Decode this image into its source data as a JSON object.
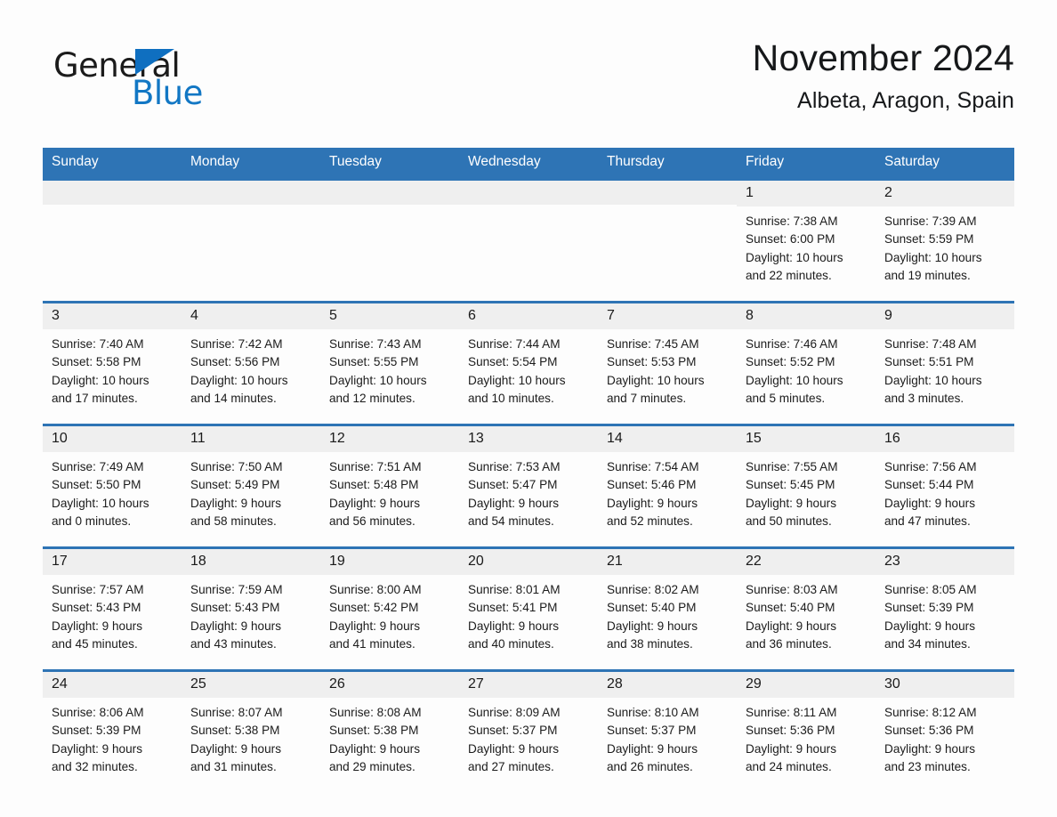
{
  "logo": {
    "word_general": "General",
    "word_blue": "Blue",
    "triangle_color": "#0f6fc0",
    "blue_text_color": "#1277c4"
  },
  "header": {
    "month_title": "November 2024",
    "location": "Albeta, Aragon, Spain"
  },
  "theme": {
    "header_blue": "#2e74b5",
    "day_band_gray": "#efefef",
    "page_background": "#fdfdfd"
  },
  "calendar": {
    "weekdays": [
      "Sunday",
      "Monday",
      "Tuesday",
      "Wednesday",
      "Thursday",
      "Friday",
      "Saturday"
    ],
    "weeks": [
      [
        {
          "day": "",
          "lines": []
        },
        {
          "day": "",
          "lines": []
        },
        {
          "day": "",
          "lines": []
        },
        {
          "day": "",
          "lines": []
        },
        {
          "day": "",
          "lines": []
        },
        {
          "day": "1",
          "lines": [
            "Sunrise: 7:38 AM",
            "Sunset: 6:00 PM",
            "Daylight: 10 hours",
            "and 22 minutes."
          ]
        },
        {
          "day": "2",
          "lines": [
            "Sunrise: 7:39 AM",
            "Sunset: 5:59 PM",
            "Daylight: 10 hours",
            "and 19 minutes."
          ]
        }
      ],
      [
        {
          "day": "3",
          "lines": [
            "Sunrise: 7:40 AM",
            "Sunset: 5:58 PM",
            "Daylight: 10 hours",
            "and 17 minutes."
          ]
        },
        {
          "day": "4",
          "lines": [
            "Sunrise: 7:42 AM",
            "Sunset: 5:56 PM",
            "Daylight: 10 hours",
            "and 14 minutes."
          ]
        },
        {
          "day": "5",
          "lines": [
            "Sunrise: 7:43 AM",
            "Sunset: 5:55 PM",
            "Daylight: 10 hours",
            "and 12 minutes."
          ]
        },
        {
          "day": "6",
          "lines": [
            "Sunrise: 7:44 AM",
            "Sunset: 5:54 PM",
            "Daylight: 10 hours",
            "and 10 minutes."
          ]
        },
        {
          "day": "7",
          "lines": [
            "Sunrise: 7:45 AM",
            "Sunset: 5:53 PM",
            "Daylight: 10 hours",
            "and 7 minutes."
          ]
        },
        {
          "day": "8",
          "lines": [
            "Sunrise: 7:46 AM",
            "Sunset: 5:52 PM",
            "Daylight: 10 hours",
            "and 5 minutes."
          ]
        },
        {
          "day": "9",
          "lines": [
            "Sunrise: 7:48 AM",
            "Sunset: 5:51 PM",
            "Daylight: 10 hours",
            "and 3 minutes."
          ]
        }
      ],
      [
        {
          "day": "10",
          "lines": [
            "Sunrise: 7:49 AM",
            "Sunset: 5:50 PM",
            "Daylight: 10 hours",
            "and 0 minutes."
          ]
        },
        {
          "day": "11",
          "lines": [
            "Sunrise: 7:50 AM",
            "Sunset: 5:49 PM",
            "Daylight: 9 hours",
            "and 58 minutes."
          ]
        },
        {
          "day": "12",
          "lines": [
            "Sunrise: 7:51 AM",
            "Sunset: 5:48 PM",
            "Daylight: 9 hours",
            "and 56 minutes."
          ]
        },
        {
          "day": "13",
          "lines": [
            "Sunrise: 7:53 AM",
            "Sunset: 5:47 PM",
            "Daylight: 9 hours",
            "and 54 minutes."
          ]
        },
        {
          "day": "14",
          "lines": [
            "Sunrise: 7:54 AM",
            "Sunset: 5:46 PM",
            "Daylight: 9 hours",
            "and 52 minutes."
          ]
        },
        {
          "day": "15",
          "lines": [
            "Sunrise: 7:55 AM",
            "Sunset: 5:45 PM",
            "Daylight: 9 hours",
            "and 50 minutes."
          ]
        },
        {
          "day": "16",
          "lines": [
            "Sunrise: 7:56 AM",
            "Sunset: 5:44 PM",
            "Daylight: 9 hours",
            "and 47 minutes."
          ]
        }
      ],
      [
        {
          "day": "17",
          "lines": [
            "Sunrise: 7:57 AM",
            "Sunset: 5:43 PM",
            "Daylight: 9 hours",
            "and 45 minutes."
          ]
        },
        {
          "day": "18",
          "lines": [
            "Sunrise: 7:59 AM",
            "Sunset: 5:43 PM",
            "Daylight: 9 hours",
            "and 43 minutes."
          ]
        },
        {
          "day": "19",
          "lines": [
            "Sunrise: 8:00 AM",
            "Sunset: 5:42 PM",
            "Daylight: 9 hours",
            "and 41 minutes."
          ]
        },
        {
          "day": "20",
          "lines": [
            "Sunrise: 8:01 AM",
            "Sunset: 5:41 PM",
            "Daylight: 9 hours",
            "and 40 minutes."
          ]
        },
        {
          "day": "21",
          "lines": [
            "Sunrise: 8:02 AM",
            "Sunset: 5:40 PM",
            "Daylight: 9 hours",
            "and 38 minutes."
          ]
        },
        {
          "day": "22",
          "lines": [
            "Sunrise: 8:03 AM",
            "Sunset: 5:40 PM",
            "Daylight: 9 hours",
            "and 36 minutes."
          ]
        },
        {
          "day": "23",
          "lines": [
            "Sunrise: 8:05 AM",
            "Sunset: 5:39 PM",
            "Daylight: 9 hours",
            "and 34 minutes."
          ]
        }
      ],
      [
        {
          "day": "24",
          "lines": [
            "Sunrise: 8:06 AM",
            "Sunset: 5:39 PM",
            "Daylight: 9 hours",
            "and 32 minutes."
          ]
        },
        {
          "day": "25",
          "lines": [
            "Sunrise: 8:07 AM",
            "Sunset: 5:38 PM",
            "Daylight: 9 hours",
            "and 31 minutes."
          ]
        },
        {
          "day": "26",
          "lines": [
            "Sunrise: 8:08 AM",
            "Sunset: 5:38 PM",
            "Daylight: 9 hours",
            "and 29 minutes."
          ]
        },
        {
          "day": "27",
          "lines": [
            "Sunrise: 8:09 AM",
            "Sunset: 5:37 PM",
            "Daylight: 9 hours",
            "and 27 minutes."
          ]
        },
        {
          "day": "28",
          "lines": [
            "Sunrise: 8:10 AM",
            "Sunset: 5:37 PM",
            "Daylight: 9 hours",
            "and 26 minutes."
          ]
        },
        {
          "day": "29",
          "lines": [
            "Sunrise: 8:11 AM",
            "Sunset: 5:36 PM",
            "Daylight: 9 hours",
            "and 24 minutes."
          ]
        },
        {
          "day": "30",
          "lines": [
            "Sunrise: 8:12 AM",
            "Sunset: 5:36 PM",
            "Daylight: 9 hours",
            "and 23 minutes."
          ]
        }
      ]
    ]
  }
}
